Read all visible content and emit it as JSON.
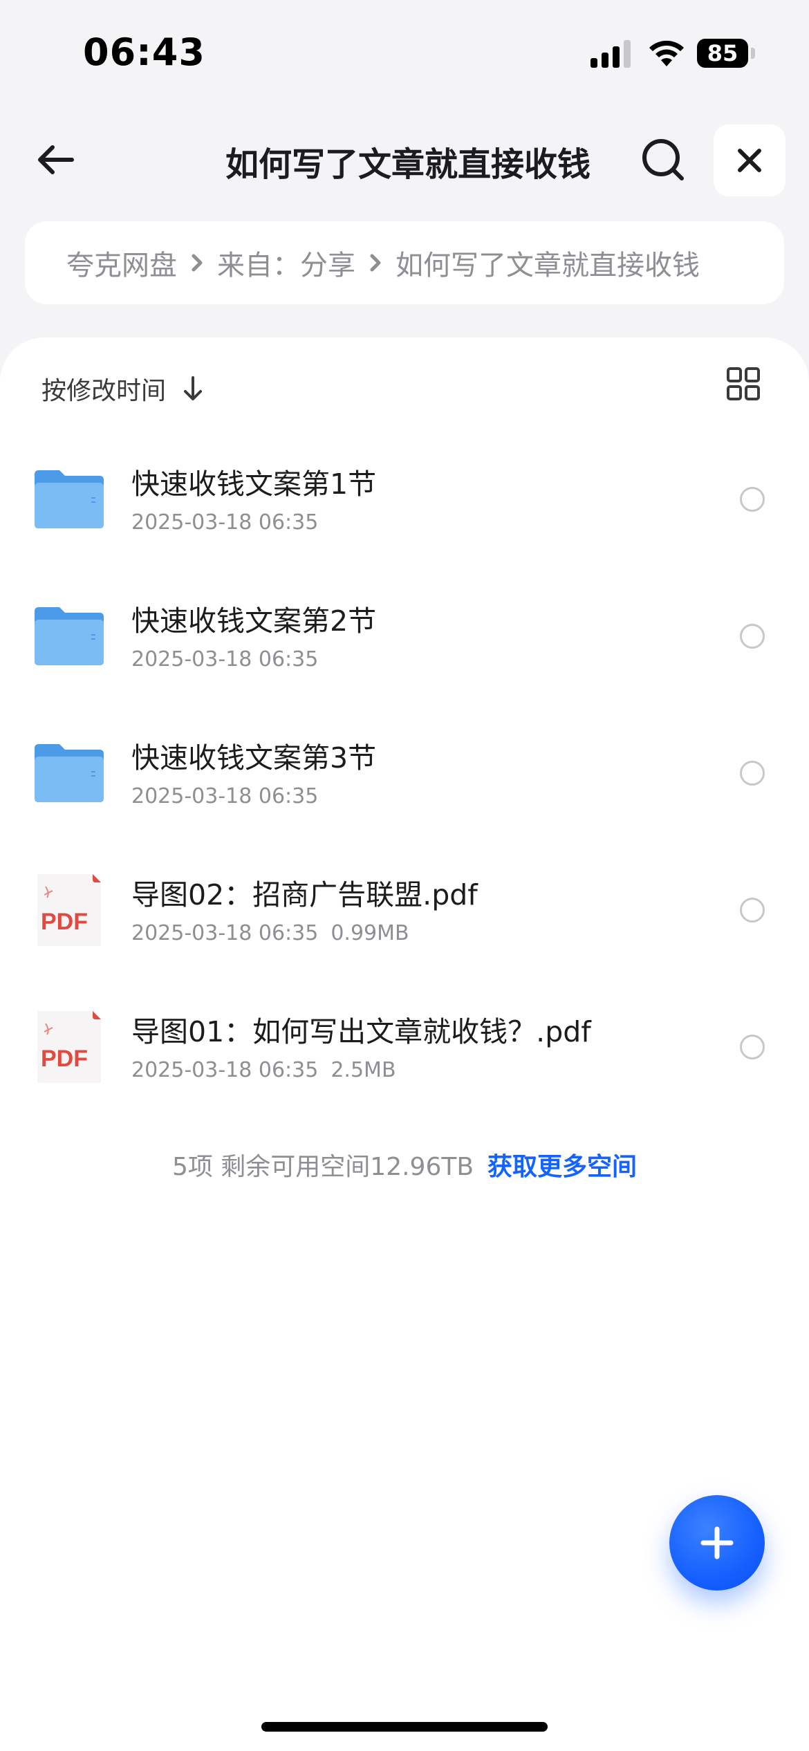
{
  "status_bar": {
    "time": "06:43",
    "battery_level": "85"
  },
  "nav": {
    "title": "如何写了文章就直接收钱",
    "back_icon": "arrow-left-icon",
    "search_icon": "search-icon",
    "close_icon": "close-icon"
  },
  "breadcrumb": {
    "items": [
      "夸克网盘",
      "来自：分享",
      "如何写了文章就直接收钱"
    ]
  },
  "sort": {
    "label": "按修改时间",
    "direction_icon": "arrow-down-icon",
    "view_icon": "grid-view-icon"
  },
  "files": [
    {
      "name": "快速收钱文案第1节",
      "date": "2025-03-18 06:35",
      "size": "",
      "type": "folder"
    },
    {
      "name": "快速收钱文案第2节",
      "date": "2025-03-18 06:35",
      "size": "",
      "type": "folder"
    },
    {
      "name": "快速收钱文案第3节",
      "date": "2025-03-18 06:35",
      "size": "",
      "type": "folder"
    },
    {
      "name": "导图02：招商广告联盟.pdf",
      "date": "2025-03-18 06:35",
      "size": "0.99MB",
      "type": "pdf"
    },
    {
      "name": "导图01：如何写出文章就收钱？.pdf",
      "date": "2025-03-18 06:35",
      "size": "2.5MB",
      "type": "pdf"
    }
  ],
  "pdf_label": "PDF",
  "footer": {
    "summary": "5项 剩余可用空间12.96TB",
    "link": "获取更多空间"
  },
  "colors": {
    "accent": "#1463ff",
    "folder": "#5aa9f0",
    "pdf": "#e04a3f",
    "background": "#f4f4f6"
  }
}
